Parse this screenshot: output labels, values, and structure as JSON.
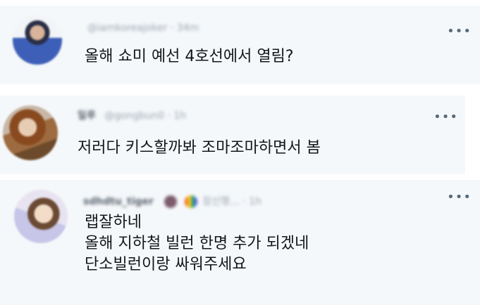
{
  "comments": [
    {
      "meta": {
        "name": "",
        "handle": "@iamkoreajoker",
        "time": "34m"
      },
      "lines": [
        "올해 쇼미 예선 4호선에서 열림?"
      ]
    },
    {
      "meta": {
        "name": "밀루",
        "handle": "@gongbun0",
        "time": "1h"
      },
      "lines": [
        "저러다 키스할까봐 조마조마하면서 봄"
      ]
    },
    {
      "meta": {
        "name": "sdhdtu_tiger",
        "handle": "잠신행…",
        "time": "1h"
      },
      "lines": [
        "랩잘하네",
        "올해 지하철 빌런 한명 추가 되겠네",
        "단소빌런이랑 싸워주세요"
      ]
    }
  ],
  "more_icon": "more-horizontal-icon",
  "more_glyph": "•••",
  "colors": {
    "card_bg": "#f5f8fa",
    "text": "#14171a",
    "muted": "#586b7b"
  }
}
